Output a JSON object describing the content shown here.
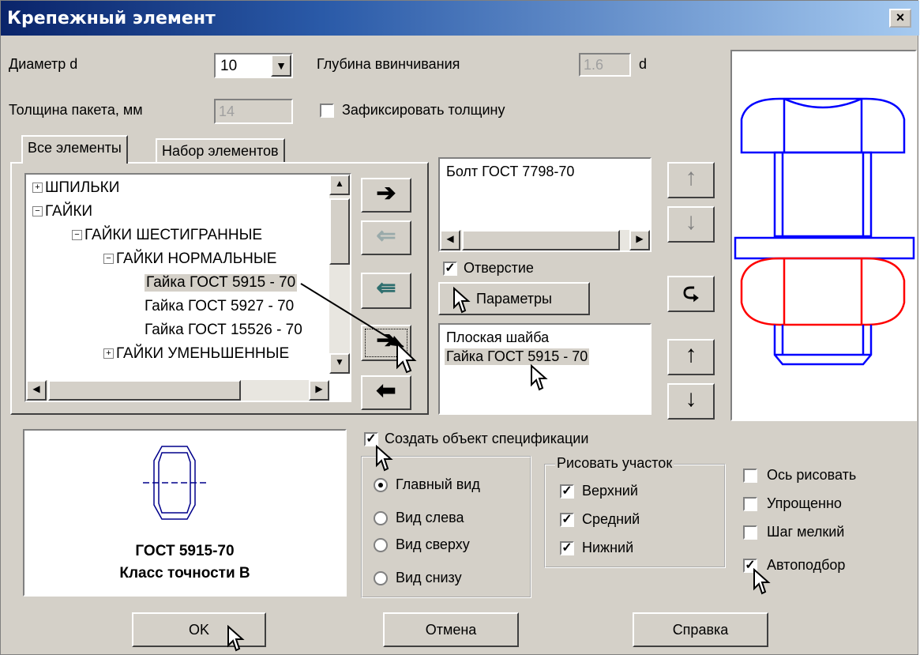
{
  "window": {
    "title": "Крепежный элемент",
    "close": "×"
  },
  "top": {
    "diameter_label": "Диаметр d",
    "diameter_value": "10",
    "depth_label": "Глубина ввинчивания",
    "depth_value": "1.6",
    "depth_unit": "d",
    "thickness_label": "Толщина пакета, мм",
    "thickness_value": "14",
    "fix_thickness_label": "Зафиксировать толщину",
    "fix_thickness_checked": false
  },
  "tabs": [
    "Все элементы",
    "Набор элементов"
  ],
  "tree": [
    {
      "label": "ШПИЛЬКИ",
      "expander": "+",
      "level": 0
    },
    {
      "label": "ГАЙКИ",
      "expander": "−",
      "level": 0
    },
    {
      "label": "ГАЙКИ ШЕСТИГРАННЫЕ",
      "expander": "−",
      "level": 1
    },
    {
      "label": "ГАЙКИ НОРМАЛЬНЫЕ",
      "expander": "−",
      "level": 2
    },
    {
      "label": "Гайка ГОСТ 5915 - 70",
      "expander": "",
      "level": 3,
      "selected": true
    },
    {
      "label": "Гайка ГОСТ 5927 - 70",
      "expander": "",
      "level": 3
    },
    {
      "label": "Гайка ГОСТ 15526 - 70",
      "expander": "",
      "level": 3
    },
    {
      "label": "ГАЙКИ УМЕНЬШЕННЫЕ",
      "expander": "+",
      "level": 2
    }
  ],
  "top_list": [
    "Болт ГОСТ 7798-70"
  ],
  "hole": {
    "label": "Отверстие",
    "checked": true
  },
  "params_button": "Параметры",
  "bottom_list": [
    "Плоская шайба",
    "Гайка ГОСТ 5915 - 70"
  ],
  "preview": {
    "line1": "ГОСТ 5915-70",
    "line2": "Класс точности В"
  },
  "spec": {
    "label": "Создать объект спецификации",
    "checked": true
  },
  "views": [
    {
      "label": "Главный вид",
      "selected": true
    },
    {
      "label": "Вид слева",
      "selected": false
    },
    {
      "label": "Вид сверху",
      "selected": false
    },
    {
      "label": "Вид снизу",
      "selected": false
    }
  ],
  "draw_section": {
    "title": "Рисовать участок",
    "items": [
      {
        "label": "Верхний",
        "checked": true
      },
      {
        "label": "Средний",
        "checked": true
      },
      {
        "label": "Нижний",
        "checked": true
      }
    ]
  },
  "options": [
    {
      "label": "Ось рисовать",
      "checked": false
    },
    {
      "label": "Упрощенно",
      "checked": false
    },
    {
      "label": "Шаг мелкий",
      "checked": false
    },
    {
      "label": "Автоподбор",
      "checked": true
    }
  ],
  "buttons": {
    "ok": "OK",
    "cancel": "Отмена",
    "help": "Справка"
  },
  "colors": {
    "bolt": "#0000ff",
    "nut": "#ff0000",
    "title_bar": "#0a246a"
  }
}
